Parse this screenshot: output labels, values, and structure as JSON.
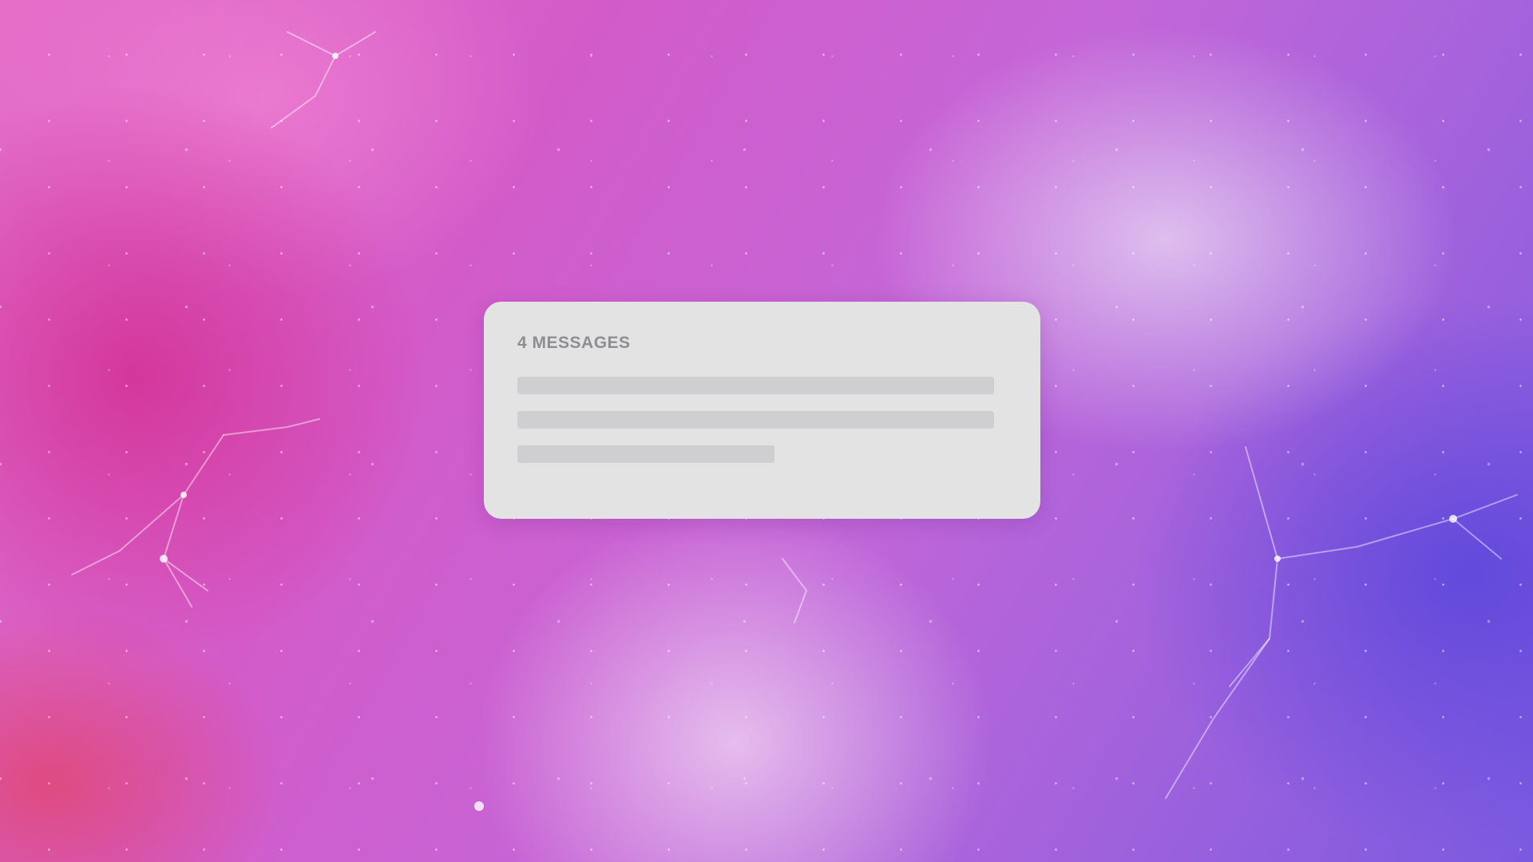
{
  "wallpaper": {
    "name": "nebula-wallpaper",
    "colors": {
      "pink": "#e46ec8",
      "magenta": "#d35bc9",
      "violet": "#a563dc",
      "blue_violet": "#7b5ae0",
      "highlight": "#f5e1f5"
    }
  },
  "notification": {
    "header": "4 MESSAGES",
    "message_count": 4,
    "placeholder_lines": 3,
    "background_color": "#e3e3e4",
    "placeholder_color": "#cfcfd2",
    "header_color": "#8e8e92"
  }
}
